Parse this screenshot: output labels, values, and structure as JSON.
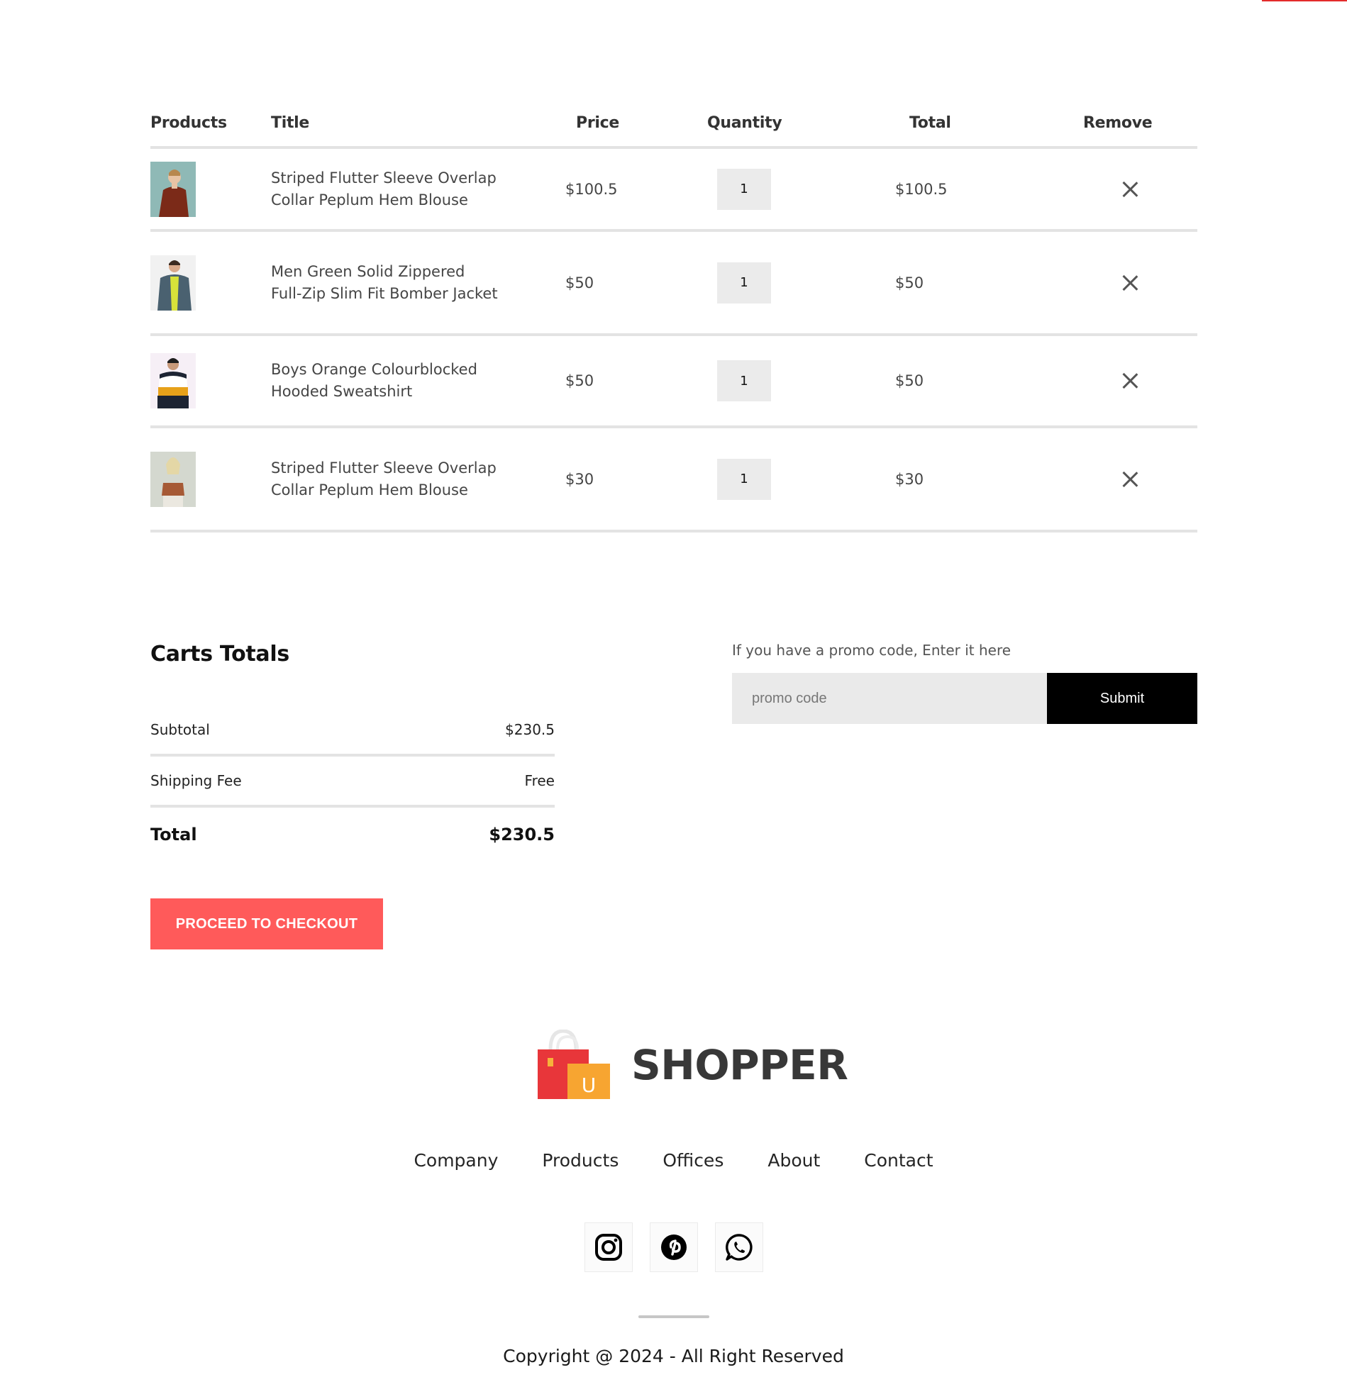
{
  "colors": {
    "accent": "#ff5a5a",
    "top_bar": "#e32b2b",
    "submit_bg": "#000000",
    "qty_bg": "#ebebeb",
    "divider": "#e3e3e3"
  },
  "cart": {
    "headers": [
      "Products",
      "Title",
      "Price",
      "Quantity",
      "Total",
      "Remove"
    ],
    "items": [
      {
        "image": "woman-in-rust-blouse",
        "title": "Striped Flutter Sleeve Overlap Collar Peplum Hem Blouse",
        "price": "$100.5",
        "quantity": "1",
        "total": "$100.5"
      },
      {
        "image": "man-in-green-jacket",
        "title": "Men Green Solid Zippered Full-Zip Slim Fit Bomber Jacket",
        "price": "$50",
        "quantity": "1",
        "total": "$50"
      },
      {
        "image": "boy-in-colourblocked-hoodie",
        "title": "Boys Orange Colourblocked Hooded Sweatshirt",
        "price": "$50",
        "quantity": "1",
        "total": "$50"
      },
      {
        "image": "woman-in-brown-top",
        "title": "Striped Flutter Sleeve Overlap Collar Peplum Hem Blouse",
        "price": "$30",
        "quantity": "1",
        "total": "$30"
      }
    ],
    "remove_icon": "close-icon"
  },
  "totals": {
    "heading": "Carts Totals",
    "subtotal_label": "Subtotal",
    "subtotal_value": "$230.5",
    "shipping_label": "Shipping Fee",
    "shipping_value": "Free",
    "total_label": "Total",
    "total_value": "$230.5",
    "checkout_label": "PROCEED TO CHECKOUT"
  },
  "promo": {
    "label": "If you have a promo code, Enter it here",
    "placeholder": "promo code",
    "submit_label": "Submit"
  },
  "footer": {
    "brand_name": "SHOPPER",
    "brand_logo_letter": "U",
    "links": [
      "Company",
      "Products",
      "Offices",
      "About",
      "Contact"
    ],
    "socials": [
      "instagram-icon",
      "pinterest-icon",
      "whatsapp-icon"
    ],
    "copyright": "Copyright @ 2024 - All Right Reserved"
  }
}
